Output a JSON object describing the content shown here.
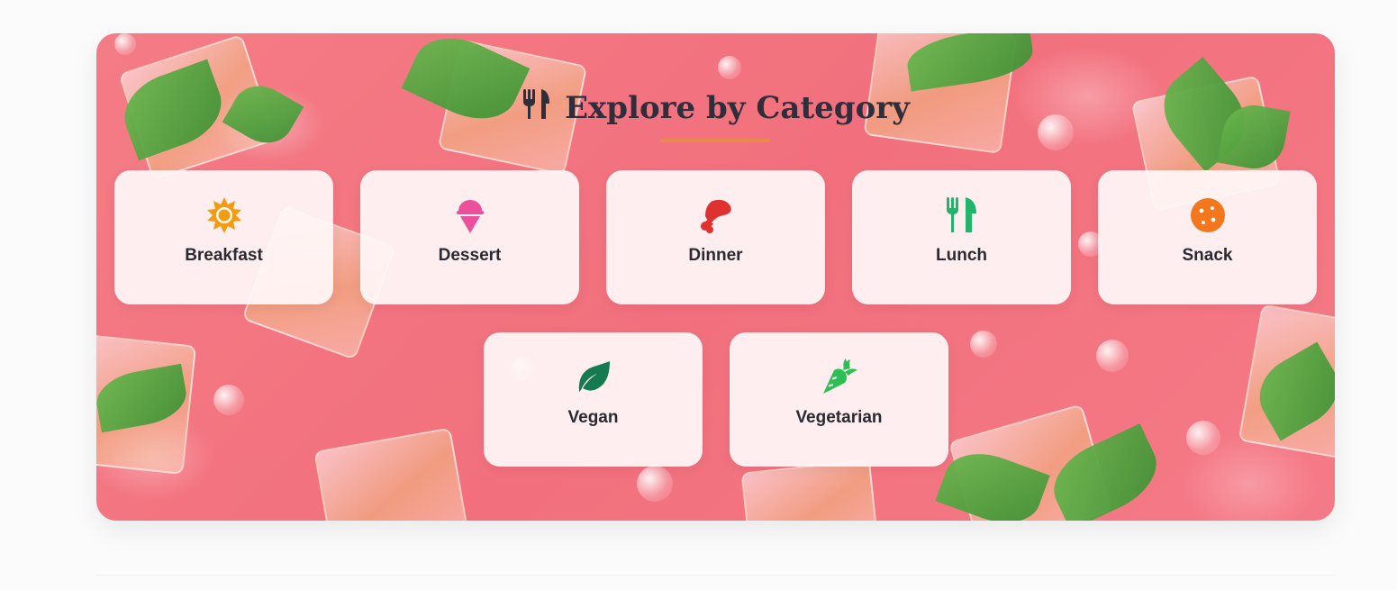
{
  "section": {
    "title": "Explore by Category",
    "title_icon": "fork-knife-icon",
    "accent_color": "#e98a4b"
  },
  "categories": [
    {
      "label": "Breakfast",
      "icon": "sun-icon",
      "color": "#f39c12"
    },
    {
      "label": "Dessert",
      "icon": "ice-cream-icon",
      "color": "#ec4f9c"
    },
    {
      "label": "Dinner",
      "icon": "drumstick-icon",
      "color": "#e03131"
    },
    {
      "label": "Lunch",
      "icon": "utensils-icon",
      "color": "#20b56b"
    },
    {
      "label": "Snack",
      "icon": "cookie-icon",
      "color": "#f2771d"
    },
    {
      "label": "Vegan",
      "icon": "leaf-icon",
      "color": "#157a4f"
    },
    {
      "label": "Vegetarian",
      "icon": "carrot-icon",
      "color": "#2dbf56"
    }
  ]
}
